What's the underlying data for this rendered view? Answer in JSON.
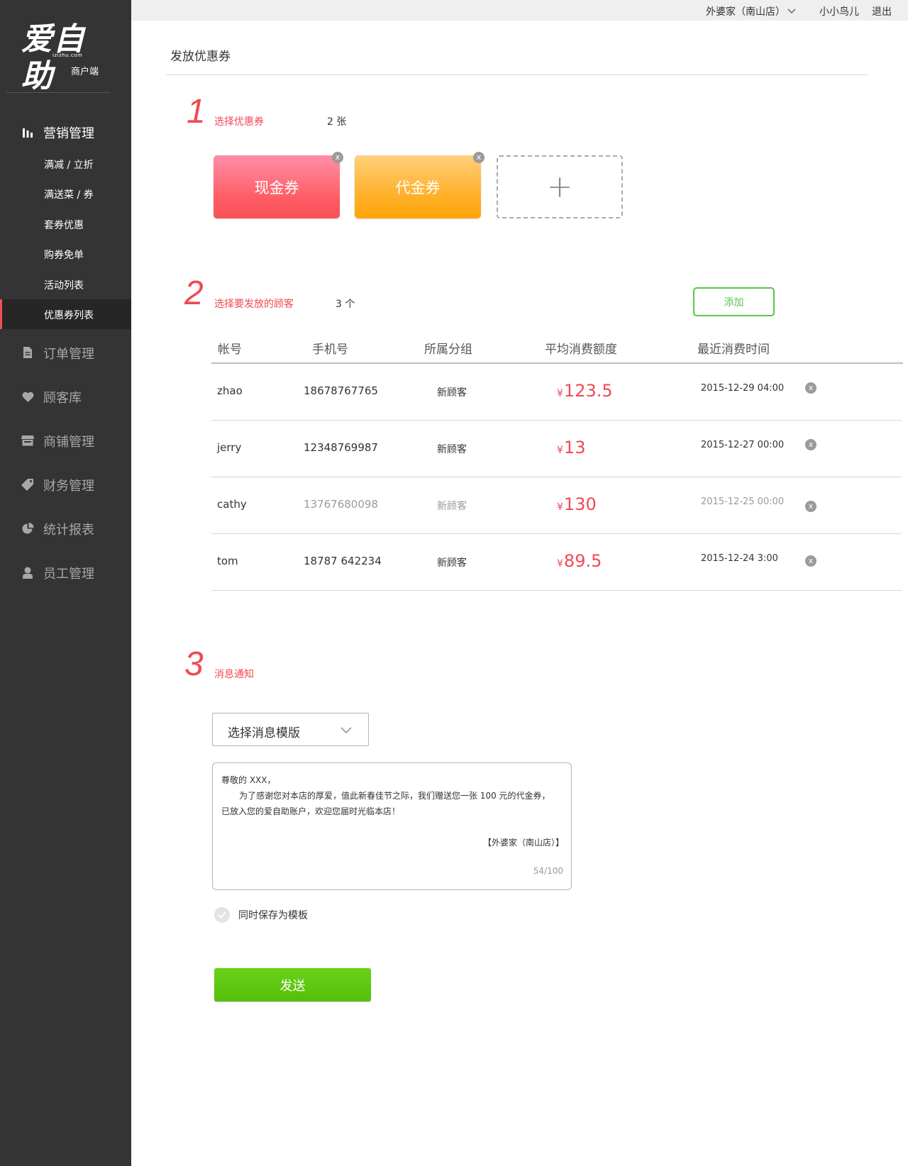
{
  "logo": {
    "main": "爱自助",
    "url": "izizhu.com",
    "subtitle": "商户端"
  },
  "topbar": {
    "store": "外婆家（南山店）",
    "user": "小小鸟儿",
    "logout": "退出"
  },
  "sidebar": {
    "marketing": "营销管理",
    "sub_items": [
      "满减 / 立折",
      "满送菜 / 券",
      "套券优惠",
      "购券免单",
      "活动列表",
      "优惠券列表"
    ],
    "orders": "订单管理",
    "customers": "顾客库",
    "shops": "商铺管理",
    "finance": "财务管理",
    "reports": "统计报表",
    "staff": "员工管理"
  },
  "page": {
    "title": "发放优惠券"
  },
  "step1": {
    "num": "1",
    "label": "选择优惠券",
    "count": "2 张",
    "coupons": [
      "现金券",
      "代金券"
    ],
    "close": "x",
    "add": "+"
  },
  "step2": {
    "num": "2",
    "label": "选择要发放的顾客",
    "count": "3 个",
    "add_button": "添加",
    "headers": [
      "帐号",
      "手机号",
      "所属分组",
      "平均消费额度",
      "最近消费时间"
    ],
    "currency": "¥",
    "rows": [
      {
        "account": "zhao",
        "phone": "18678767765",
        "group": "新顾客",
        "amount": "123.5",
        "date": "2015-12-29 04:00"
      },
      {
        "account": "jerry",
        "phone": "12348769987",
        "group": "新顾客",
        "amount": "13",
        "date": "2015-12-27 00:00"
      },
      {
        "account": "cathy",
        "phone": "13767680098",
        "group": "新顾客",
        "amount": "130",
        "date": "2015-12-25 00:00"
      },
      {
        "account": "tom",
        "phone": "18787 642234",
        "group": "新顾客",
        "amount": "89.5",
        "date": "2015-12-24 3:00"
      }
    ]
  },
  "step3": {
    "num": "3",
    "label": "消息通知",
    "template_select": "选择消息模版",
    "message": {
      "line1": "尊敬的 XXX，",
      "line2": "为了感谢您对本店的厚爱，值此新春佳节之际，我们赠送您一张 100 元的代金券，",
      "line3": "已放入您的爱自助账户，欢迎您届时光临本店！",
      "signature": "【外婆家（南山店）】",
      "counter": "54/100"
    },
    "save_template": "同时保存为模板",
    "send": "发送"
  },
  "colors": {
    "accent_red": "#f04a55",
    "green": "#59c44a",
    "sidebar_bg": "#343434"
  }
}
